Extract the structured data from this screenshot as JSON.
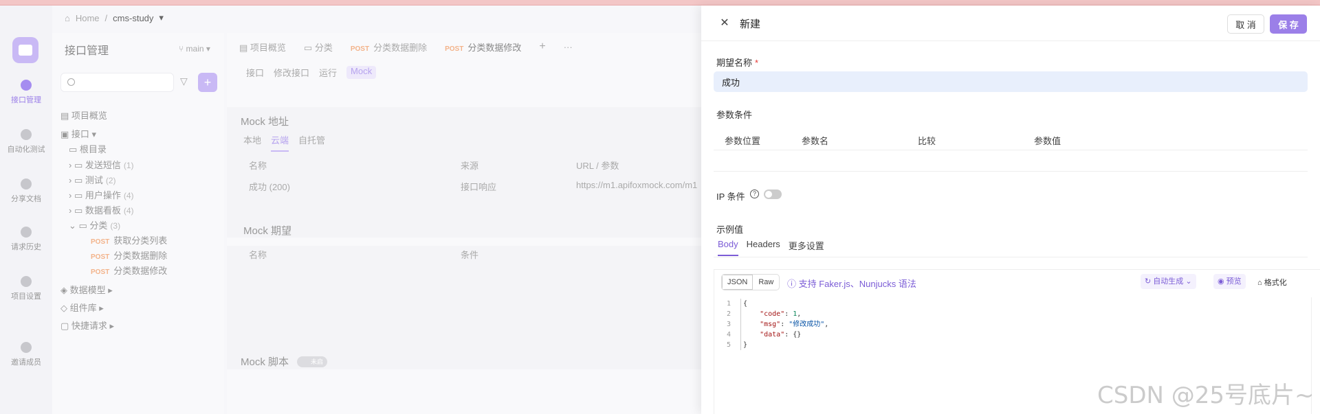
{
  "breadcrumb": {
    "home": "Home",
    "sep": "/",
    "project": "cms-study",
    "caret": "▾"
  },
  "rail": [
    {
      "label": "接口管理",
      "active": true
    },
    {
      "label": "自动化测试",
      "active": false
    },
    {
      "label": "分享文档",
      "active": false
    },
    {
      "label": "请求历史",
      "active": false
    },
    {
      "label": "项目设置",
      "active": false
    },
    {
      "label": "邀请成员",
      "active": false
    }
  ],
  "tree": {
    "title": "接口管理",
    "branch": "main",
    "overview": "项目概览",
    "api_group": "接口",
    "root": "根目录",
    "folders": [
      {
        "name": "发送短信",
        "count": "(1)"
      },
      {
        "name": "测试",
        "count": "(2)"
      },
      {
        "name": "用户操作",
        "count": "(4)"
      },
      {
        "name": "数据看板",
        "count": "(4)"
      },
      {
        "name": "分类",
        "count": "(3)"
      }
    ],
    "apis": [
      {
        "method": "POST",
        "name": "获取分类列表"
      },
      {
        "method": "POST",
        "name": "分类数据删除"
      },
      {
        "method": "POST",
        "name": "分类数据修改"
      }
    ],
    "data_model": "数据模型",
    "components": "组件库",
    "quick_request": "快捷请求"
  },
  "main": {
    "tabs": [
      {
        "label": "项目概览"
      },
      {
        "label": "分类"
      },
      {
        "method": "POST",
        "label": "分类数据删除"
      },
      {
        "method": "POST",
        "label": "分类数据修改"
      }
    ],
    "plus": "+",
    "more": "···",
    "subtabs": [
      "接口",
      "修改接口",
      "运行",
      "Mock"
    ],
    "mock_address": {
      "title": "Mock 地址",
      "tabs": [
        "本地",
        "云端",
        "自托管"
      ],
      "columns": [
        "名称",
        "来源",
        "URL / 参数"
      ],
      "row": {
        "name": "成功 (200)",
        "source": "接口响应",
        "url": "https://m1.apifoxmock.com/m1"
      }
    },
    "mock_expect": {
      "title": "Mock 期望",
      "columns": [
        "名称",
        "条件"
      ]
    },
    "mock_script": {
      "title": "Mock 脚本",
      "toggle": "未启"
    }
  },
  "panel": {
    "title": "新建",
    "close": "✕",
    "cancel": "取 消",
    "save": "保 存",
    "name_label": "期望名称",
    "required": "*",
    "name_value": "成功",
    "params_label": "参数条件",
    "params_columns": [
      "参数位置",
      "参数名",
      "比较",
      "参数值"
    ],
    "ip_label": "IP 条件",
    "ip_enabled": false,
    "example_label": "示例值",
    "example_tabs": [
      "Body",
      "Headers",
      "更多设置"
    ],
    "format_tabs": [
      "JSON",
      "Raw"
    ],
    "faker_hint": "支持 Faker.js、Nunjucks 语法",
    "auto_gen": "自动生成",
    "preview": "预览",
    "format": "格式化",
    "code_lines": [
      {
        "n": "1",
        "text": "{"
      },
      {
        "n": "2",
        "key": "\"code\"",
        "val": "1",
        "type": "num",
        "tail": ","
      },
      {
        "n": "3",
        "key": "\"msg\"",
        "val": "\"修改成功\"",
        "type": "str",
        "tail": ","
      },
      {
        "n": "4",
        "key": "\"data\"",
        "val": "{}",
        "type": "plain",
        "tail": ""
      },
      {
        "n": "5",
        "text": "}"
      }
    ]
  },
  "watermark": "CSDN @25号底片~"
}
